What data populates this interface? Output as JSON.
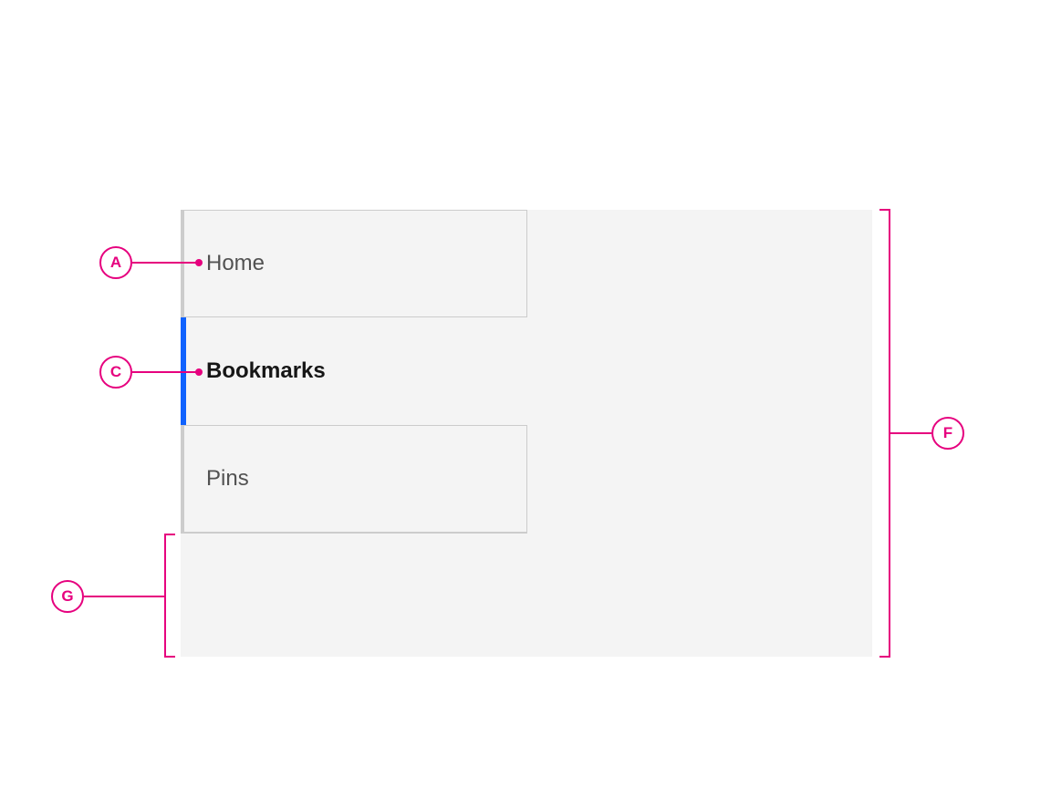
{
  "nav": {
    "items": [
      {
        "label": "Home",
        "selected": false,
        "boxed": true
      },
      {
        "label": "Bookmarks",
        "selected": true,
        "boxed": false
      },
      {
        "label": "Pins",
        "selected": false,
        "boxed": true
      }
    ]
  },
  "annotations": {
    "A": "A",
    "C": "C",
    "F": "F",
    "G": "G"
  },
  "colors": {
    "accent": "#0f62fe",
    "annotation": "#e6007e",
    "panel": "#f4f4f4",
    "border": "#cccccc"
  }
}
